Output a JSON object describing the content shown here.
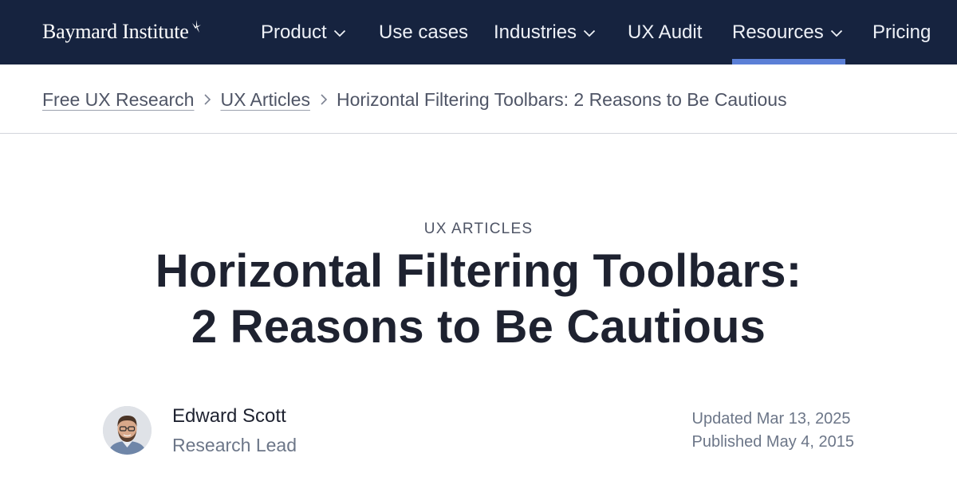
{
  "brand": {
    "name": "Baymard Institute",
    "colors": {
      "nav_bg": "#16233f",
      "accent": "#5b7fd6",
      "text": "#1e2230",
      "muted": "#6c7688"
    }
  },
  "nav": {
    "items": [
      {
        "label": "Product",
        "has_dropdown": true,
        "icon": "chevron-down-icon"
      },
      {
        "label": "Use cases",
        "has_dropdown": false
      },
      {
        "label": "Industries",
        "has_dropdown": true,
        "icon": "chevron-down-icon"
      },
      {
        "label": "UX Audit",
        "has_dropdown": false
      },
      {
        "label": "Resources",
        "has_dropdown": true,
        "icon": "chevron-down-icon",
        "active": true
      },
      {
        "label": "Pricing",
        "has_dropdown": false
      }
    ]
  },
  "breadcrumb": {
    "items": [
      {
        "label": "Free UX Research",
        "link": true
      },
      {
        "label": "UX Articles",
        "link": true
      },
      {
        "label": "Horizontal Filtering Toolbars: 2 Reasons to Be Cautious",
        "link": false
      }
    ],
    "separator_icon": "chevron-right-icon"
  },
  "article": {
    "kicker": "UX ARTICLES",
    "title_line1": "Horizontal Filtering Toolbars:",
    "title_line2": "2 Reasons to Be Cautious",
    "author": {
      "name": "Edward Scott",
      "role": "Research Lead",
      "avatar_icon": "author-avatar"
    },
    "updated": "Updated Mar 13, 2025",
    "published": "Published May 4, 2015"
  }
}
